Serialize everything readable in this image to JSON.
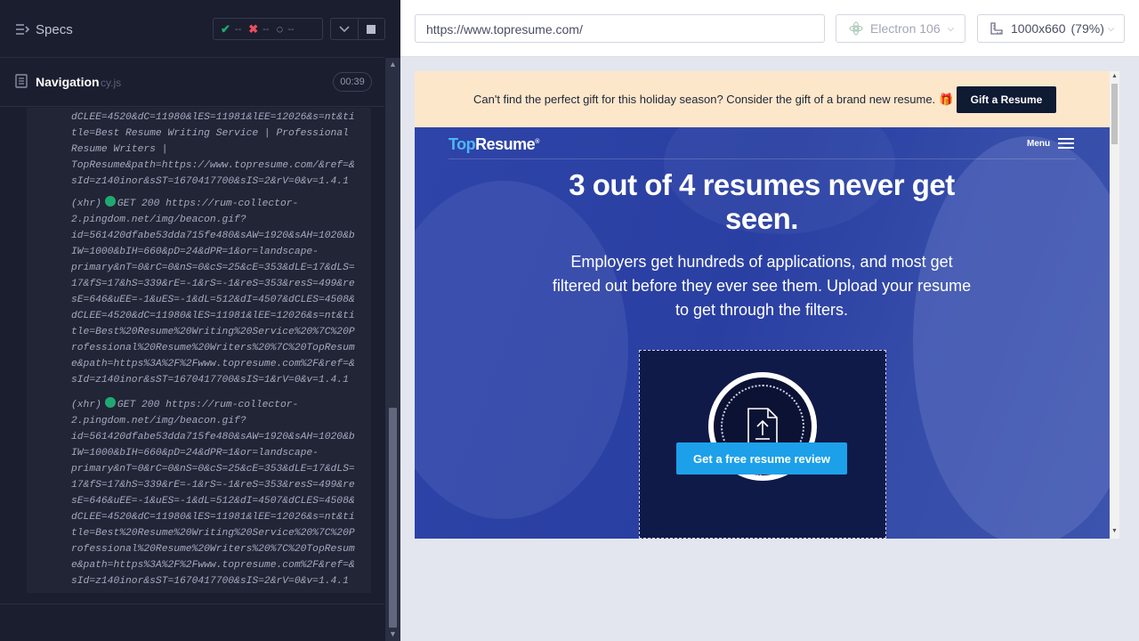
{
  "reporter": {
    "specs_label": "Specs",
    "stats": {
      "passed": "--",
      "failed": "--",
      "pending": "--"
    },
    "test_title": "Navigation",
    "test_file": "cy.js",
    "duration": "00:39",
    "log_entries": [
      {
        "text": "dCLEE=4520&dC=11980&lES=11981&lEE=12026&s=nt&ti\ntle=Best Resume Writing Service | Professional\nResume Writers |\nTopResume&path=https://www.topresume.com/&ref=&\nsId=z140inor&sST=1670417700&sIS=2&rV=0&v=1.4.1"
      },
      {
        "kind": "(xhr)",
        "method": "GET 200 https://rum-collector-",
        "text": "2.pingdom.net/img/beacon.gif?\nid=561420dfabe53dda715fe480&sAW=1920&sAH=1020&b\nIW=1000&bIH=660&pD=24&dPR=1&or=landscape-\nprimary&nT=0&rC=0&nS=0&cS=25&cE=353&dLE=17&dLS=\n17&fS=17&hS=339&rE=-1&rS=-1&reS=353&resS=499&re\nsE=646&uEE=-1&uES=-1&dL=512&dI=4507&dCLES=4508&\ndCLEE=4520&dC=11980&lES=11981&lEE=12026&s=nt&ti\ntle=Best%20Resume%20Writing%20Service%20%7C%20P\nrofessional%20Resume%20Writers%20%7C%20TopResum\ne&path=https%3A%2F%2Fwww.topresume.com%2F&ref=&\nsId=z140inor&sST=1670417700&sIS=1&rV=0&v=1.4.1"
      },
      {
        "kind": "(xhr)",
        "method": "GET 200 https://rum-collector-",
        "text": "2.pingdom.net/img/beacon.gif?\nid=561420dfabe53dda715fe480&sAW=1920&sAH=1020&b\nIW=1000&bIH=660&pD=24&dPR=1&or=landscape-\nprimary&nT=0&rC=0&nS=0&cS=25&cE=353&dLE=17&dLS=\n17&fS=17&hS=339&rE=-1&rS=-1&reS=353&resS=499&re\nsE=646&uEE=-1&uES=-1&dL=512&dI=4507&dCLES=4508&\ndCLEE=4520&dC=11980&lES=11981&lEE=12026&s=nt&ti\ntle=Best%20Resume%20Writing%20Service%20%7C%20P\nrofessional%20Resume%20Writers%20%7C%20TopResum\ne&path=https%3A%2F%2Fwww.topresume.com%2F&ref=&\nsId=z140inor&sST=1670417700&sIS=2&rV=0&v=1.4.1"
      }
    ]
  },
  "browser_bar": {
    "url": "https://www.topresume.com/",
    "browser": "Electron 106",
    "viewport": "1000x660",
    "zoom": "(79%)"
  },
  "site": {
    "banner_text": "Can't find the perfect gift for this holiday season? Consider the gift of a brand new resume.",
    "banner_button": "Gift a Resume",
    "logo_top": "Top",
    "logo_resume": "Resume",
    "menu_label": "Menu",
    "headline": "3 out of 4 resumes never get seen.",
    "subhead": "Employers get hundreds of applications, and most get filtered out before they ever see them. Upload your resume to get through the filters.",
    "cta": "Get a free resume review"
  },
  "colors": {
    "reporter_bg": "#1b1e2e",
    "pass": "#1fa971",
    "fail": "#e94f5f",
    "hero_blue": "#2f44a8",
    "cta_blue": "#1ca0ea",
    "banner_bg": "#fde7cb"
  }
}
